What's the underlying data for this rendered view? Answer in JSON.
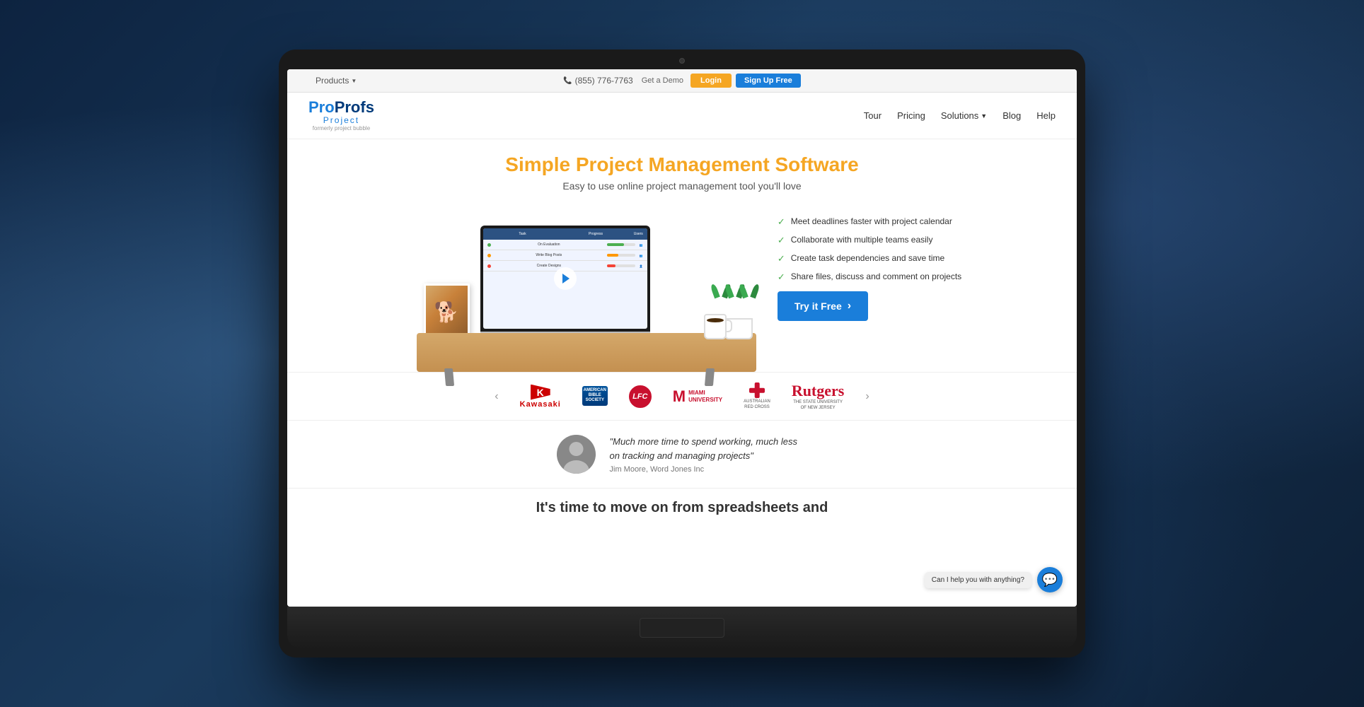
{
  "topbar": {
    "products_label": "Products",
    "phone": "(855) 776-7763",
    "get_demo": "Get a Demo",
    "login": "Login",
    "signup": "Sign Up Free"
  },
  "nav": {
    "logo_pro": "Pro",
    "logo_profs": "Profs",
    "logo_project": "Project",
    "logo_formerly": "formerly project bubble",
    "links": {
      "tour": "Tour",
      "pricing": "Pricing",
      "solutions": "Solutions",
      "blog": "Blog",
      "help": "Help"
    }
  },
  "hero": {
    "title": "Simple Project Management Software",
    "subtitle": "Easy to use online project management tool you'll love",
    "features": [
      "Meet deadlines faster with project calendar",
      "Collaborate with multiple teams easily",
      "Create task dependencies and save time",
      "Share files, discuss and comment on projects"
    ],
    "cta_button": "Try it Free",
    "cta_arrow": "›"
  },
  "tasks": [
    {
      "name": "On Evaluation",
      "progress": 60,
      "color": "green"
    },
    {
      "name": "Write Blog Posts",
      "progress": 40,
      "color": "orange"
    },
    {
      "name": "Create Designs",
      "progress": 30,
      "color": "red"
    }
  ],
  "logos": {
    "prev_arrow": "‹",
    "next_arrow": "›",
    "companies": [
      "Kawasaki",
      "American Bible Society",
      "LFC",
      "Miami University",
      "Australian Red Cross",
      "Rutgers"
    ]
  },
  "testimonial": {
    "quote": "\"Much more time to spend working, much less on tracking and managing projects\"",
    "author": "Jim Moore, Word Jones Inc"
  },
  "bottom_cta": {
    "text": "It's time to move on from spreadsheets and"
  },
  "chat": {
    "bubble_text": "Can I help you with anything?",
    "icon": "💬"
  }
}
